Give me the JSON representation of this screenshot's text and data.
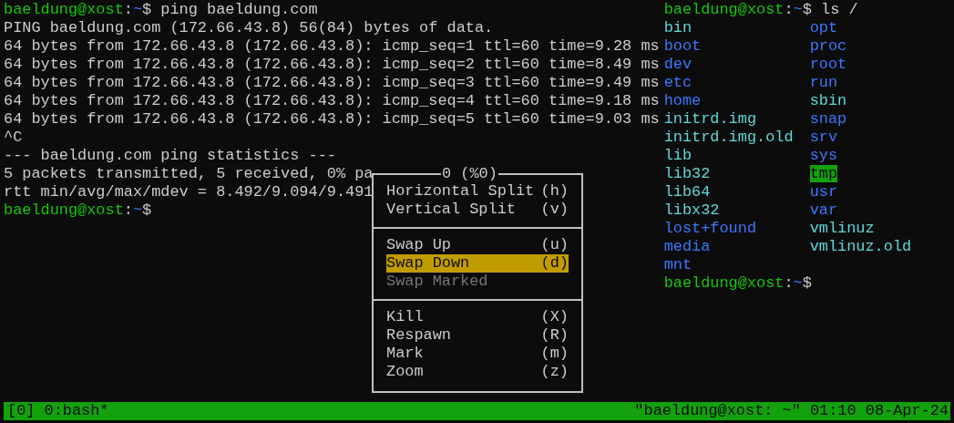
{
  "left_pane": {
    "lines": [
      {
        "kind": "prompt",
        "prompt": {
          "user_host": "baeldung@xost",
          "separator": ":",
          "path": "~",
          "symbol": "$"
        },
        "command": "ping baeldung.com"
      },
      {
        "kind": "output",
        "text": "PING baeldung.com (172.66.43.8) 56(84) bytes of data."
      },
      {
        "kind": "output",
        "text": "64 bytes from 172.66.43.8 (172.66.43.8): icmp_seq=1 ttl=60 time=9.28 ms"
      },
      {
        "kind": "output",
        "text": "64 bytes from 172.66.43.8 (172.66.43.8): icmp_seq=2 ttl=60 time=8.49 ms"
      },
      {
        "kind": "output",
        "text": "64 bytes from 172.66.43.8 (172.66.43.8): icmp_seq=3 ttl=60 time=9.49 ms"
      },
      {
        "kind": "output",
        "text": "64 bytes from 172.66.43.8 (172.66.43.8): icmp_seq=4 ttl=60 time=9.18 ms"
      },
      {
        "kind": "output",
        "text": "64 bytes from 172.66.43.8 (172.66.43.8): icmp_seq=5 ttl=60 time=9.03 ms"
      },
      {
        "kind": "output",
        "text": "^C"
      },
      {
        "kind": "output",
        "text": "--- baeldung.com ping statistics ---"
      },
      {
        "kind": "output",
        "text": "5 packets transmitted, 5 received, 0% pa"
      },
      {
        "kind": "output",
        "text": "rtt min/avg/max/mdev = 8.492/9.094/9.491"
      },
      {
        "kind": "prompt",
        "prompt": {
          "user_host": "baeldung@xost",
          "separator": ":",
          "path": "~",
          "symbol": "$"
        }
      }
    ]
  },
  "right_pane": {
    "command_prompt": {
      "prompt": {
        "user_host": "baeldung@xost",
        "separator": ":",
        "path": "~",
        "symbol": "$"
      },
      "command": "ls /"
    },
    "listing": [
      [
        {
          "name": "bin",
          "kind": "link"
        },
        {
          "name": "boot",
          "kind": "dir"
        },
        {
          "name": "dev",
          "kind": "dir"
        },
        {
          "name": "etc",
          "kind": "dir"
        },
        {
          "name": "home",
          "kind": "dir"
        },
        {
          "name": "initrd.img",
          "kind": "link"
        },
        {
          "name": "initrd.img.old",
          "kind": "link"
        },
        {
          "name": "lib",
          "kind": "link"
        },
        {
          "name": "lib32",
          "kind": "link"
        },
        {
          "name": "lib64",
          "kind": "link"
        },
        {
          "name": "libx32",
          "kind": "link"
        },
        {
          "name": "lost+found",
          "kind": "dir"
        },
        {
          "name": "media",
          "kind": "dir"
        },
        {
          "name": "mnt",
          "kind": "dir"
        }
      ],
      [
        {
          "name": "opt",
          "kind": "dir"
        },
        {
          "name": "proc",
          "kind": "dir"
        },
        {
          "name": "root",
          "kind": "dir"
        },
        {
          "name": "run",
          "kind": "dir"
        },
        {
          "name": "sbin",
          "kind": "link"
        },
        {
          "name": "snap",
          "kind": "dir"
        },
        {
          "name": "srv",
          "kind": "dir"
        },
        {
          "name": "sys",
          "kind": "dir"
        },
        {
          "name": "tmp",
          "kind": "sticky"
        },
        {
          "name": "usr",
          "kind": "dir"
        },
        {
          "name": "var",
          "kind": "dir"
        },
        {
          "name": "vmlinuz",
          "kind": "link"
        },
        {
          "name": "vmlinuz.old",
          "kind": "link"
        }
      ]
    ],
    "end_prompt": {
      "user_host": "baeldung@xost",
      "separator": ":",
      "path": "~",
      "symbol": "$"
    }
  },
  "pane_menu": {
    "title": "0 (%0)",
    "sections": [
      [
        {
          "label": "Horizontal Split",
          "key": "(h)",
          "selected": false,
          "disabled": false
        },
        {
          "label": "Vertical Split",
          "key": "(v)",
          "selected": false,
          "disabled": false
        }
      ],
      [
        {
          "label": "Swap Up",
          "key": "(u)",
          "selected": false,
          "disabled": false
        },
        {
          "label": "Swap Down",
          "key": "(d)",
          "selected": true,
          "disabled": false
        },
        {
          "label": "Swap Marked",
          "selected": false,
          "disabled": true
        }
      ],
      [
        {
          "label": "Kill",
          "key": "(X)",
          "selected": false,
          "disabled": false
        },
        {
          "label": "Respawn",
          "key": "(R)",
          "selected": false,
          "disabled": false
        },
        {
          "label": "Mark",
          "key": "(m)",
          "selected": false,
          "disabled": false
        },
        {
          "label": "Zoom",
          "key": "(z)",
          "selected": false,
          "disabled": false
        }
      ]
    ]
  },
  "status_bar": {
    "window_list": "[0] 0:bash*",
    "right_text": "\"baeldung@xost: ~\" 01:10 08-Apr-24"
  }
}
